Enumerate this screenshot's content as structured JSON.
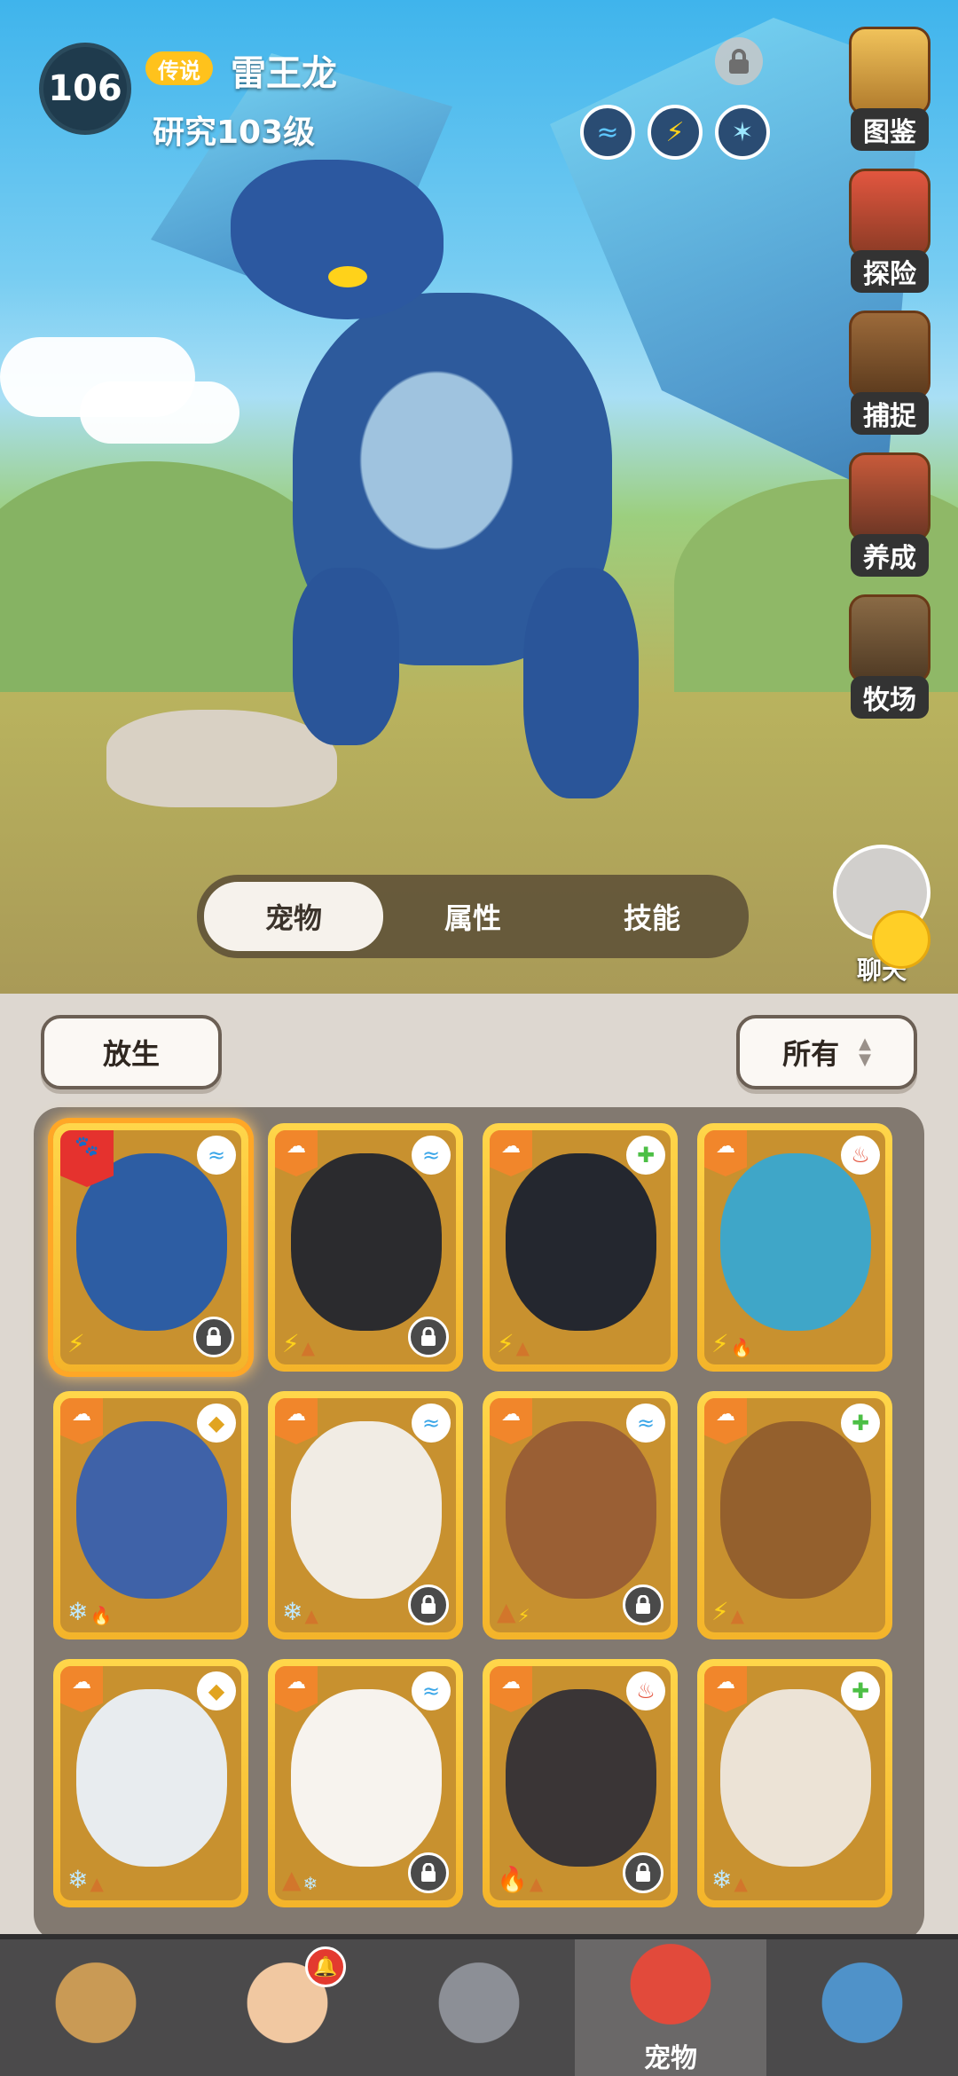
{
  "pet": {
    "level": "106",
    "rarity": "传说",
    "name": "雷王龙",
    "research": "研究103级",
    "elements": [
      "water-icon",
      "lightning-icon",
      "wind-icon"
    ]
  },
  "side_menu": [
    {
      "id": "collection",
      "label": "图鉴",
      "icon": "book-icon"
    },
    {
      "id": "adventure",
      "label": "探险",
      "icon": "explore-icon"
    },
    {
      "id": "capture",
      "label": "捕捉",
      "icon": "cage-icon"
    },
    {
      "id": "breed",
      "label": "养成",
      "icon": "breed-icon"
    },
    {
      "id": "ranch",
      "label": "牧场",
      "icon": "ranch-icon"
    }
  ],
  "chat": {
    "label": "聊天"
  },
  "tabs": [
    {
      "label": "宠物",
      "active": true
    },
    {
      "label": "属性",
      "active": false
    },
    {
      "label": "技能",
      "active": false
    }
  ],
  "actions": {
    "release": "放生",
    "filter": "所有"
  },
  "cards": [
    {
      "name": "thunder-dragon",
      "element": "water",
      "selected": true,
      "locked": true,
      "traits": [
        "⚡"
      ],
      "portrait": "#2d5da3"
    },
    {
      "name": "black-lightning-beast",
      "element": "water",
      "selected": false,
      "locked": true,
      "traits": [
        "⚡",
        "▲"
      ],
      "portrait": "#2b2b2e"
    },
    {
      "name": "black-whale",
      "element": "heal",
      "selected": false,
      "locked": false,
      "traits": [
        "⚡",
        "▲"
      ],
      "portrait": "#24272f"
    },
    {
      "name": "blue-raptor",
      "element": "fire",
      "selected": false,
      "locked": false,
      "traits": [
        "⚡",
        "🔥"
      ],
      "portrait": "#3fa6c8"
    },
    {
      "name": "frost-wolf",
      "element": "earth",
      "selected": false,
      "locked": false,
      "traits": [
        "❄",
        "🔥"
      ],
      "portrait": "#3f62a8"
    },
    {
      "name": "white-llama",
      "element": "water",
      "selected": false,
      "locked": true,
      "traits": [
        "❄",
        "▲"
      ],
      "portrait": "#f1ece4"
    },
    {
      "name": "brown-sheep",
      "element": "water",
      "selected": false,
      "locked": true,
      "traits": [
        "▲",
        "⚡"
      ],
      "portrait": "#9a5f34"
    },
    {
      "name": "rhino-beast",
      "element": "heal",
      "selected": false,
      "locked": false,
      "traits": [
        "⚡",
        "▲"
      ],
      "portrait": "#94602d"
    },
    {
      "name": "white-yeti",
      "element": "earth",
      "selected": false,
      "locked": false,
      "traits": [
        "❄",
        "▲"
      ],
      "portrait": "#e8ecef"
    },
    {
      "name": "fluffy-bird",
      "element": "water",
      "selected": false,
      "locked": true,
      "traits": [
        "▲",
        "❄"
      ],
      "portrait": "#f7f3ee"
    },
    {
      "name": "lava-dragon",
      "element": "fire",
      "selected": false,
      "locked": true,
      "traits": [
        "🔥",
        "▲"
      ],
      "portrait": "#3a3536"
    },
    {
      "name": "mountain-goat",
      "element": "heal",
      "selected": false,
      "locked": false,
      "traits": [
        "❄",
        "▲"
      ],
      "portrait": "#ece3d6"
    }
  ],
  "nav": [
    {
      "id": "tribe",
      "label": "",
      "active": false,
      "color": "#c99a55"
    },
    {
      "id": "hero",
      "label": "",
      "active": false,
      "color": "#f1c8a1",
      "bell": true
    },
    {
      "id": "battle",
      "label": "",
      "active": false,
      "color": "#8c8f96"
    },
    {
      "id": "pets",
      "label": "宠物",
      "active": true,
      "color": "#e24a3b"
    },
    {
      "id": "portal",
      "label": "",
      "active": false,
      "color": "#4f92c9"
    }
  ]
}
